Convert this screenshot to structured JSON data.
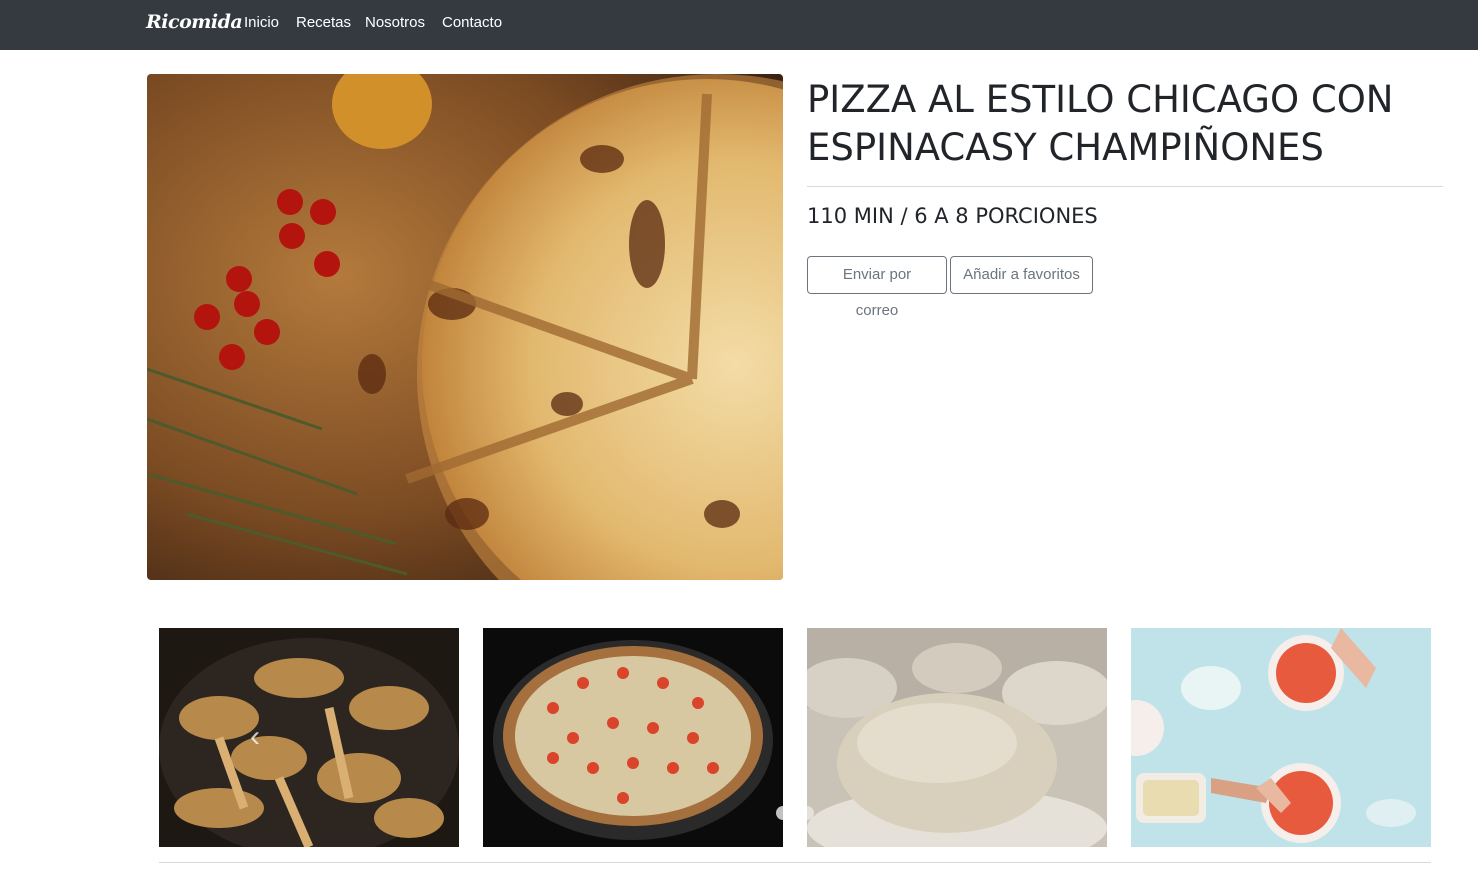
{
  "navbar": {
    "brand": "Ricomida",
    "links": [
      {
        "label": "Inicio"
      },
      {
        "label": "Recetas"
      },
      {
        "label": "Nosotros"
      },
      {
        "label": "Contacto"
      }
    ],
    "background": "#343a40"
  },
  "recipe": {
    "title": "PIZZA AL ESTILO CHICAGO CON ESPINACASY CHAMPIÑONES",
    "meta": "110 MIN / 6 A 8 PORCIONES",
    "actions": {
      "email_label": "Enviar por correo",
      "favorite_label": "Añadir a favoritos"
    }
  },
  "gallery": {
    "images": [
      {
        "name": "chanterelle-mushrooms"
      },
      {
        "name": "baked-pizza-with-tomatoes"
      },
      {
        "name": "pizza-dough-ball"
      },
      {
        "name": "hands-preparing-pizzas"
      }
    ],
    "prev_control": "‹",
    "indicators": 2
  },
  "colors": {
    "text": "#212529",
    "secondary": "#6c757d"
  }
}
